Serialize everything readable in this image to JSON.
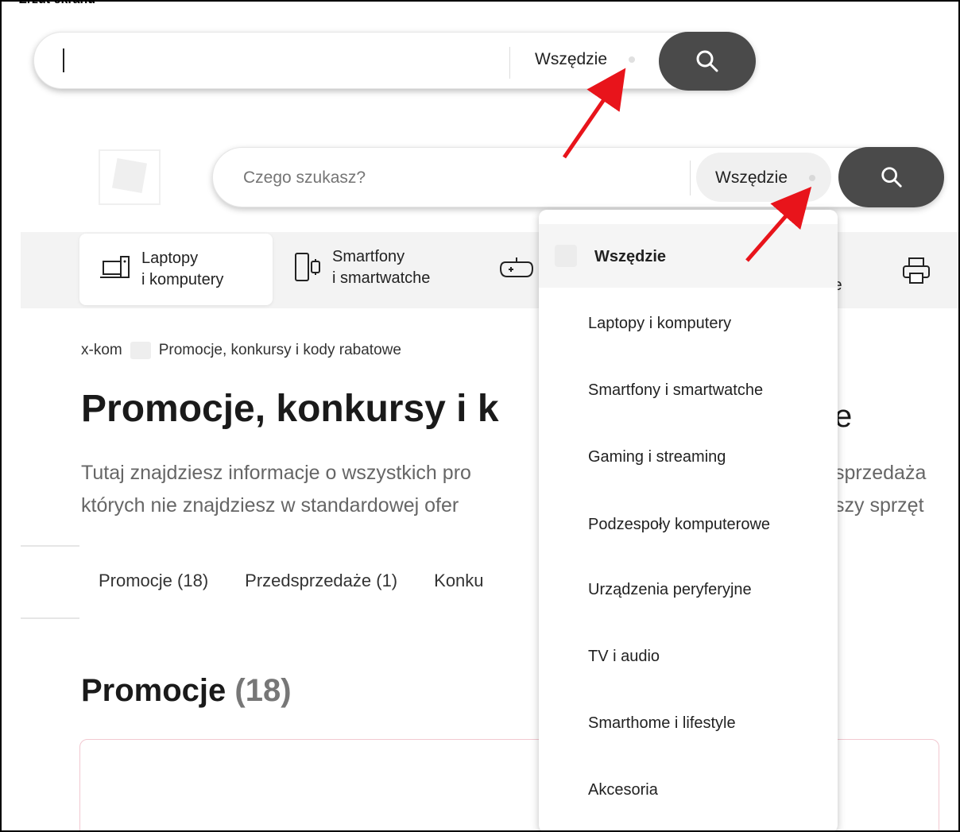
{
  "caption": "Zrzut ekranu",
  "search_top": {
    "value": "",
    "scope_label": "Wszędzie"
  },
  "search_main": {
    "placeholder": "Czego szukasz?",
    "scope_label": "Wszędzie"
  },
  "categories": [
    {
      "line1": "Laptopy",
      "line2": "i komputery",
      "icon": "laptop-icon"
    },
    {
      "line1": "Smartfony",
      "line2": "i smartwatche",
      "icon": "smartphone-icon"
    },
    {
      "icon": "gamepad-icon"
    },
    {
      "tail": "we"
    },
    {
      "icon": "printer-icon"
    }
  ],
  "breadcrumb": {
    "home": "x-kom",
    "current": "Promocje, konkursy i kody rabatowe"
  },
  "page_title": "Promocje, konkursy i k",
  "page_title_tail": "e",
  "description": {
    "line1": "Tutaj znajdziesz informacje o wszystkich pro",
    "line2": "których nie znajdziesz w standardowej ofer",
    "line1_right": "sprzedaża",
    "line2_right": "szy sprzęt"
  },
  "tabs": [
    "Promocje (18)",
    "Przedsprzedaże (1)",
    "Konku"
  ],
  "section": {
    "title": "Promocje",
    "count": "(18)"
  },
  "dropdown": {
    "items": [
      "Wszędzie",
      "Laptopy i komputery",
      "Smartfony i smartwatche",
      "Gaming i streaming",
      "Podzespoły komputerowe",
      "Urządzenia peryferyjne",
      "TV i audio",
      "Smarthome i lifestyle",
      "Akcesoria"
    ]
  },
  "colors": {
    "button": "#4a4a4a",
    "arrow": "#e8141b"
  }
}
